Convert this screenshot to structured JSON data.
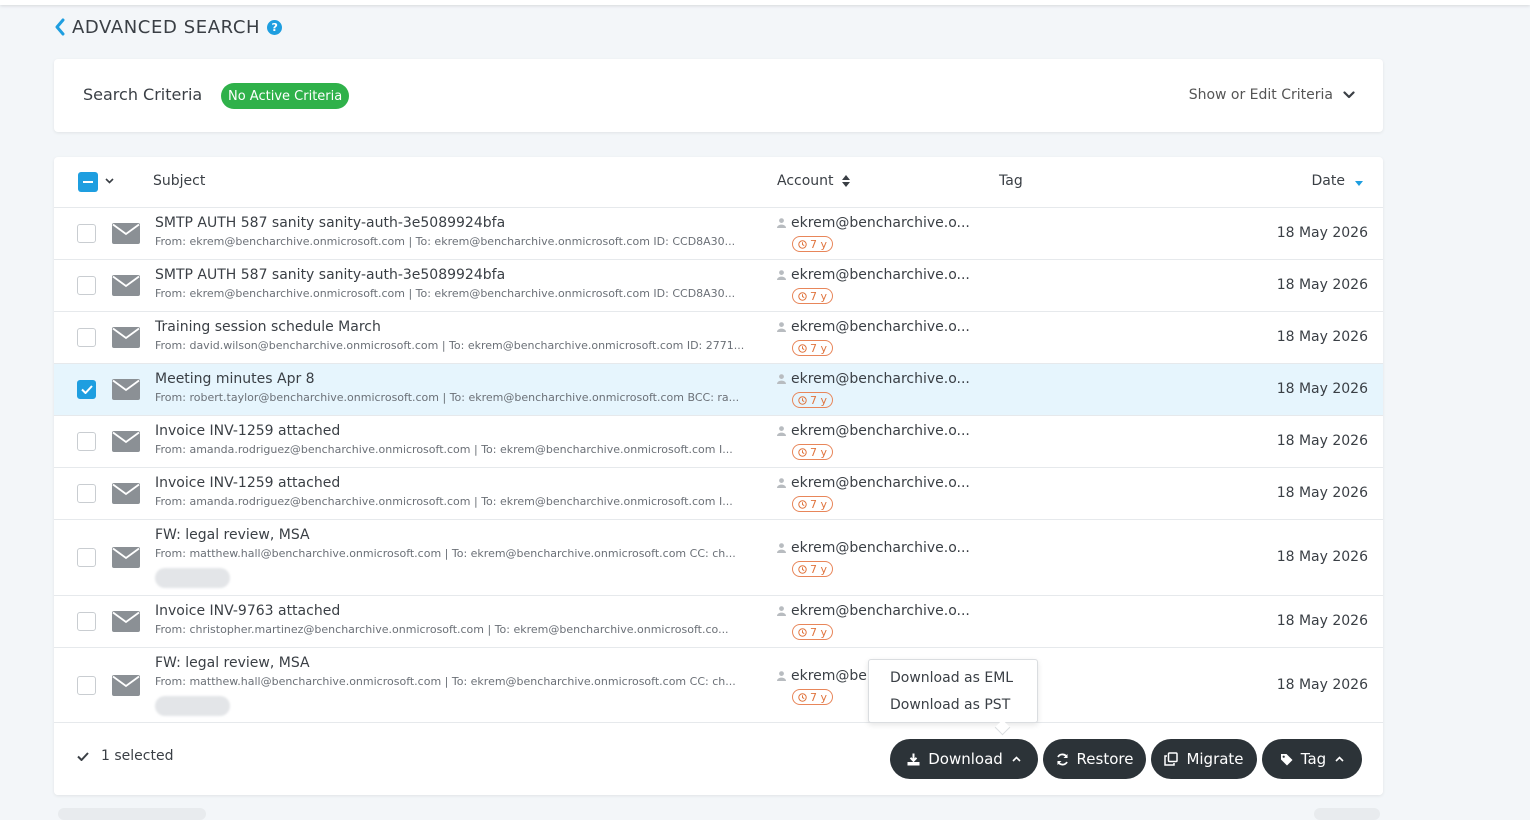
{
  "header": {
    "title": "ADVANCED SEARCH",
    "help_glyph": "?"
  },
  "criteria": {
    "title": "Search Criteria",
    "badge": "No Active Criteria",
    "toggle_label": "Show or Edit Criteria",
    "badge_color": "#2fb14a"
  },
  "table": {
    "columns": {
      "subject": "Subject",
      "account": "Account",
      "tag": "Tag",
      "date": "Date"
    },
    "rows": [
      {
        "subject": "SMTP AUTH 587 sanity sanity-auth-3e5089924bfa",
        "meta": "From: ekrem@bencharchive.onmicrosoft.com | To: ekrem@bencharchive.onmicrosoft.com ID: CCD8A30...",
        "account": "ekrem@bencharchive.o...",
        "retention": "7 y",
        "date": "18 May 2026",
        "selected": false,
        "has_tag_pill": false
      },
      {
        "subject": "SMTP AUTH 587 sanity sanity-auth-3e5089924bfa",
        "meta": "From: ekrem@bencharchive.onmicrosoft.com | To: ekrem@bencharchive.onmicrosoft.com ID: CCD8A30...",
        "account": "ekrem@bencharchive.o...",
        "retention": "7 y",
        "date": "18 May 2026",
        "selected": false,
        "has_tag_pill": false
      },
      {
        "subject": "Training session schedule March",
        "meta": "From: david.wilson@bencharchive.onmicrosoft.com | To: ekrem@bencharchive.onmicrosoft.com ID: 2771...",
        "account": "ekrem@bencharchive.o...",
        "retention": "7 y",
        "date": "18 May 2026",
        "selected": false,
        "has_tag_pill": false
      },
      {
        "subject": "Meeting minutes Apr 8",
        "meta": "From: robert.taylor@bencharchive.onmicrosoft.com | To: ekrem@bencharchive.onmicrosoft.com BCC: ra...",
        "account": "ekrem@bencharchive.o...",
        "retention": "7 y",
        "date": "18 May 2026",
        "selected": true,
        "has_tag_pill": false
      },
      {
        "subject": "Invoice INV-1259 attached",
        "meta": "From: amanda.rodriguez@bencharchive.onmicrosoft.com | To: ekrem@bencharchive.onmicrosoft.com I...",
        "account": "ekrem@bencharchive.o...",
        "retention": "7 y",
        "date": "18 May 2026",
        "selected": false,
        "has_tag_pill": false
      },
      {
        "subject": "Invoice INV-1259 attached",
        "meta": "From: amanda.rodriguez@bencharchive.onmicrosoft.com | To: ekrem@bencharchive.onmicrosoft.com I...",
        "account": "ekrem@bencharchive.o...",
        "retention": "7 y",
        "date": "18 May 2026",
        "selected": false,
        "has_tag_pill": false
      },
      {
        "subject": "FW: legal review, MSA",
        "meta": "From: matthew.hall@bencharchive.onmicrosoft.com | To: ekrem@bencharchive.onmicrosoft.com CC: ch...",
        "account": "ekrem@bencharchive.o...",
        "retention": "7 y",
        "date": "18 May 2026",
        "selected": false,
        "has_tag_pill": true
      },
      {
        "subject": "Invoice INV-9763 attached",
        "meta": "From: christopher.martinez@bencharchive.onmicrosoft.com | To: ekrem@bencharchive.onmicrosoft.co...",
        "account": "ekrem@bencharchive.o...",
        "retention": "7 y",
        "date": "18 May 2026",
        "selected": false,
        "has_tag_pill": false
      },
      {
        "subject": "FW: legal review, MSA",
        "meta": "From: matthew.hall@bencharchive.onmicrosoft.com | To: ekrem@bencharchive.onmicrosoft.com CC: ch...",
        "account": "ekrem@be",
        "retention": "7 y",
        "date": "18 May 2026",
        "selected": false,
        "has_tag_pill": true
      }
    ]
  },
  "footer": {
    "selected_label": "1 selected",
    "buttons": {
      "download": "Download",
      "restore": "Restore",
      "migrate": "Migrate",
      "tag": "Tag"
    }
  },
  "download_menu": {
    "items": [
      "Download as EML",
      "Download as PST"
    ]
  },
  "colors": {
    "accent": "#1e9ee0",
    "selected_row": "#e6f5fd",
    "dark_button": "#2c3338",
    "retention_orange": "#e0753f"
  }
}
